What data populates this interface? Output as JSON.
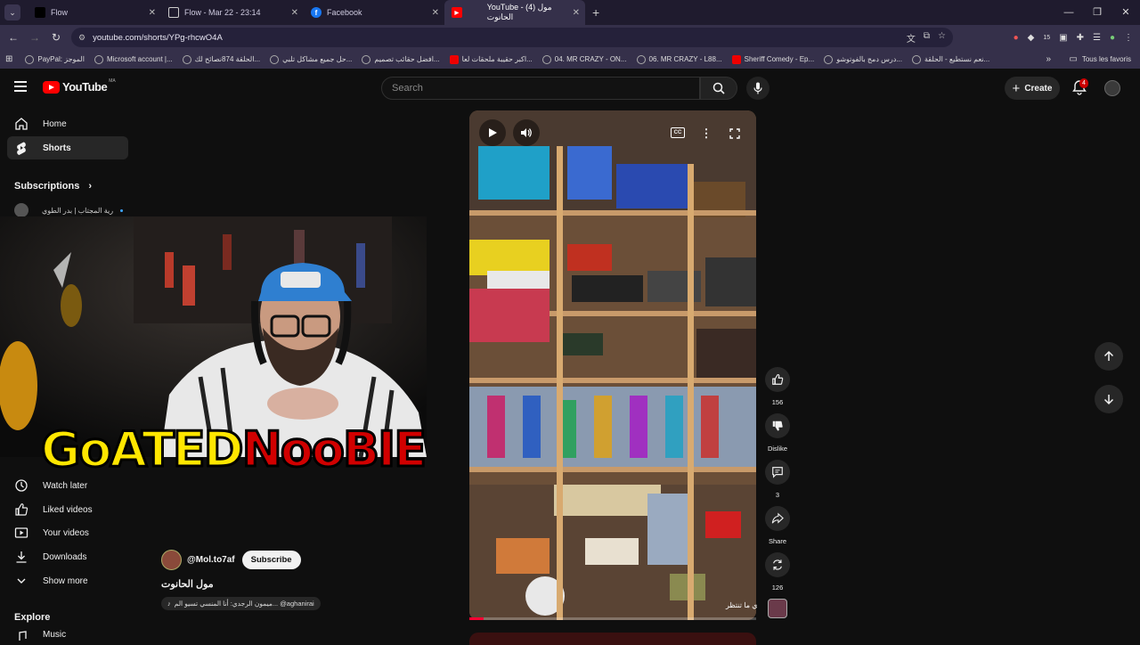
{
  "browser": {
    "tabs": [
      {
        "title": "Flow",
        "active": false
      },
      {
        "title": "Flow - Mar 22 - 23:14",
        "active": false
      },
      {
        "title": "Facebook",
        "active": false
      },
      {
        "title": "YouTube - (4) مول الحانوت",
        "active": true
      }
    ],
    "url": "youtube.com/shorts/YPg-rhcwO4A",
    "ext_count": "15",
    "bookmarks": [
      {
        "label": "PayPal: الموجز",
        "icon": "globe-icon"
      },
      {
        "label": "Microsoft account |...",
        "icon": "globe-icon"
      },
      {
        "label": "الحلقة 874نصائح لك...",
        "icon": "globe-icon"
      },
      {
        "label": "حل جميع مشاكل تلبي...",
        "icon": "globe-icon"
      },
      {
        "label": "افضل حقائب تصميم...",
        "icon": "globe-icon"
      },
      {
        "label": "اكبر حقيبة ملحقات لعا...",
        "icon": "youtube-icon"
      },
      {
        "label": "04. MR CRAZY - ON...",
        "icon": "globe-icon"
      },
      {
        "label": "06. MR CRAZY - L88...",
        "icon": "globe-icon"
      },
      {
        "label": "Sheriff Comedy - Ep...",
        "icon": "youtube-icon"
      },
      {
        "label": "درس دمج بالفوتوشو...",
        "icon": "globe-icon"
      },
      {
        "label": "نعم نستطيع - الحلقة...",
        "icon": "globe-icon"
      }
    ],
    "all_bookmarks": "Tous les favoris"
  },
  "header": {
    "logo": "YouTube",
    "country": "MA",
    "search_placeholder": "Search",
    "create_label": "Create",
    "notification_count": "4"
  },
  "sidebar": {
    "items": [
      {
        "label": "Home",
        "icon": "home-icon"
      },
      {
        "label": "Shorts",
        "icon": "shorts-icon"
      }
    ],
    "subscriptions_title": "Subscriptions",
    "subscription": "رية المجتاب | بدر الطوي",
    "lower_items": [
      {
        "label": "Watch later",
        "icon": "clock-icon"
      },
      {
        "label": "Liked videos",
        "icon": "thumbs-up-icon"
      },
      {
        "label": "Your videos",
        "icon": "video-icon"
      },
      {
        "label": "Downloads",
        "icon": "download-icon"
      },
      {
        "label": "Show more",
        "icon": "chevron-down-icon"
      }
    ],
    "explore_title": "Explore",
    "music": "Music"
  },
  "overlay": {
    "logo_part1": "GoATED",
    "logo_part2": "NooBIE"
  },
  "short": {
    "likes": "156",
    "dislike_label": "Dislike",
    "comments": "3",
    "share_label": "Share",
    "remix_count": "126",
    "music_tag": "ي ما تنتظر",
    "progress": 0.05,
    "channel": "@Mol.to7af",
    "subscribe_label": "Subscribe",
    "title": "مول الحانوت",
    "sound": "ميمون الرجدي: أنا المنسي تسيو الم... @aghanirai"
  },
  "colors": {
    "accent": "#ff0000",
    "background": "#0f0f0f",
    "surface": "#272727"
  }
}
